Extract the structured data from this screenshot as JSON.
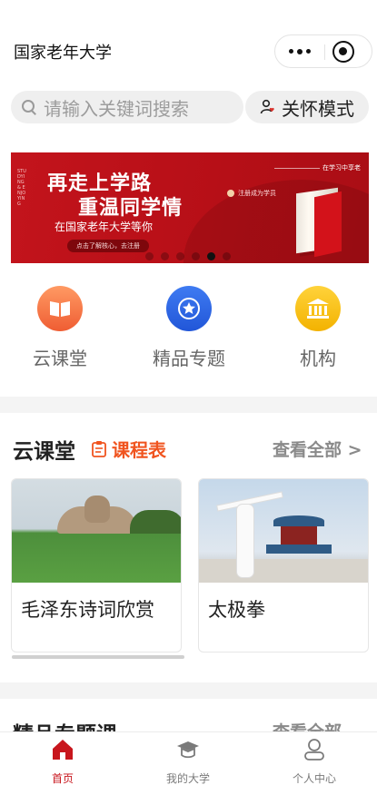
{
  "header": {
    "title": "国家老年大学"
  },
  "search": {
    "placeholder": "请输入关键词搜索"
  },
  "care_mode": {
    "label": "关怀模式"
  },
  "banner": {
    "line1": "再走上学路",
    "line2": "重温同学情",
    "line3": "在国家老年大学等你",
    "cta": "点击了解核心，去注册",
    "note": "注册成为学员",
    "tag": "在学习中享老",
    "side_text": "STUDYING & ENJOYING",
    "slide_count": 6,
    "active_slide": 5
  },
  "quick_nav": [
    {
      "label": "云课堂",
      "icon": "book-icon",
      "color": "#f2693c"
    },
    {
      "label": "精品专题",
      "icon": "star-icon",
      "color": "#2f66e3"
    },
    {
      "label": "机构",
      "icon": "institution-icon",
      "color": "#f7bf10"
    }
  ],
  "cloud_class": {
    "title": "云课堂",
    "schedule_label": "课程表",
    "view_all": "查看全部 >",
    "courses": [
      {
        "name": "毛泽东诗词欣赏"
      },
      {
        "name": "太极拳"
      }
    ]
  },
  "next_section": {
    "title": "精品专题课",
    "view_all": "查看全部"
  },
  "tabbar": {
    "items": [
      {
        "label": "首页",
        "icon": "home-icon",
        "active": true
      },
      {
        "label": "我的大学",
        "icon": "graduation-cap-icon",
        "active": false
      },
      {
        "label": "个人中心",
        "icon": "user-icon",
        "active": false
      }
    ]
  },
  "colors": {
    "brand_red": "#c8161d",
    "orange": "#f0541f",
    "muted": "#8a8a8a"
  }
}
